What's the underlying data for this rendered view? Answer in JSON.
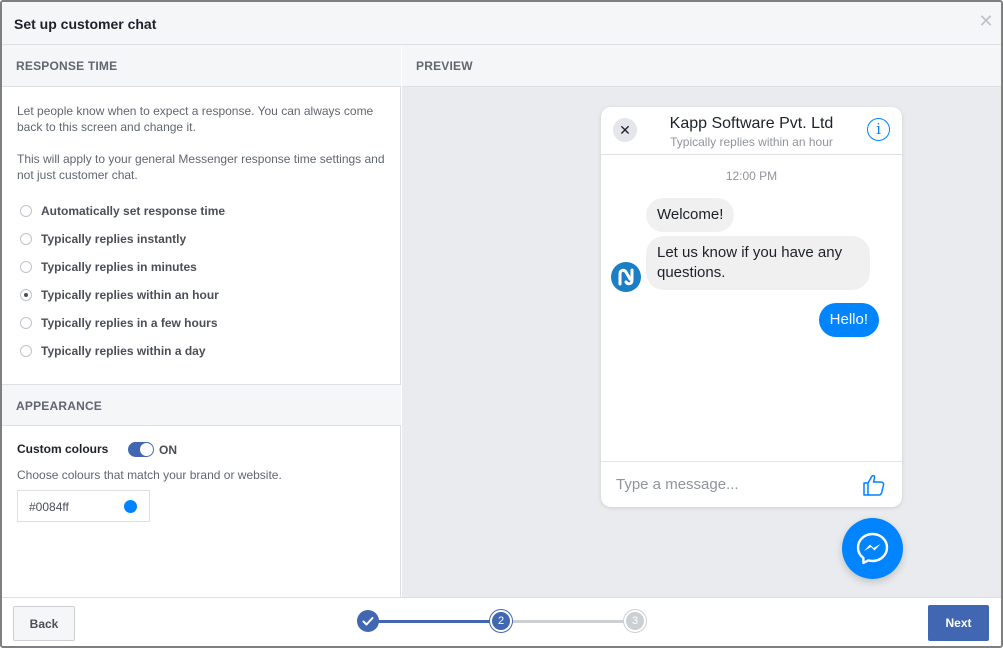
{
  "dialog": {
    "title": "Set up customer chat",
    "close_icon": "close-icon"
  },
  "response_time": {
    "heading": "RESPONSE TIME",
    "desc1": "Let people know when to expect a response. You can always come back to this screen and change it.",
    "desc2": "This will apply to your general Messenger response time settings and not just customer chat.",
    "options": [
      {
        "label": "Automatically set response time",
        "checked": false
      },
      {
        "label": "Typically replies instantly",
        "checked": false
      },
      {
        "label": "Typically replies in minutes",
        "checked": false
      },
      {
        "label": "Typically replies within an hour",
        "checked": true
      },
      {
        "label": "Typically replies in a few hours",
        "checked": false
      },
      {
        "label": "Typically replies within a day",
        "checked": false
      }
    ]
  },
  "appearance": {
    "heading": "APPEARANCE",
    "custom_colours_label": "Custom colours",
    "toggle_state": "ON",
    "hint": "Choose colours that match your brand or website.",
    "color_value": "#0084ff"
  },
  "preview": {
    "heading": "PREVIEW",
    "chat": {
      "name": "Kapp Software Pvt. Ltd",
      "subtitle": "Typically replies within an hour",
      "time": "12:00 PM",
      "messages": [
        {
          "text": "Welcome!",
          "from": "page"
        },
        {
          "text": "Let us know if you have any questions.",
          "from": "page"
        },
        {
          "text": "Hello!",
          "from": "user"
        }
      ],
      "input_placeholder": "Type a message...",
      "accent": "#0084ff"
    }
  },
  "footer": {
    "back_label": "Back",
    "next_label": "Next",
    "steps": [
      {
        "label": "",
        "state": "done"
      },
      {
        "label": "2",
        "state": "current"
      },
      {
        "label": "3",
        "state": "pending"
      }
    ]
  }
}
